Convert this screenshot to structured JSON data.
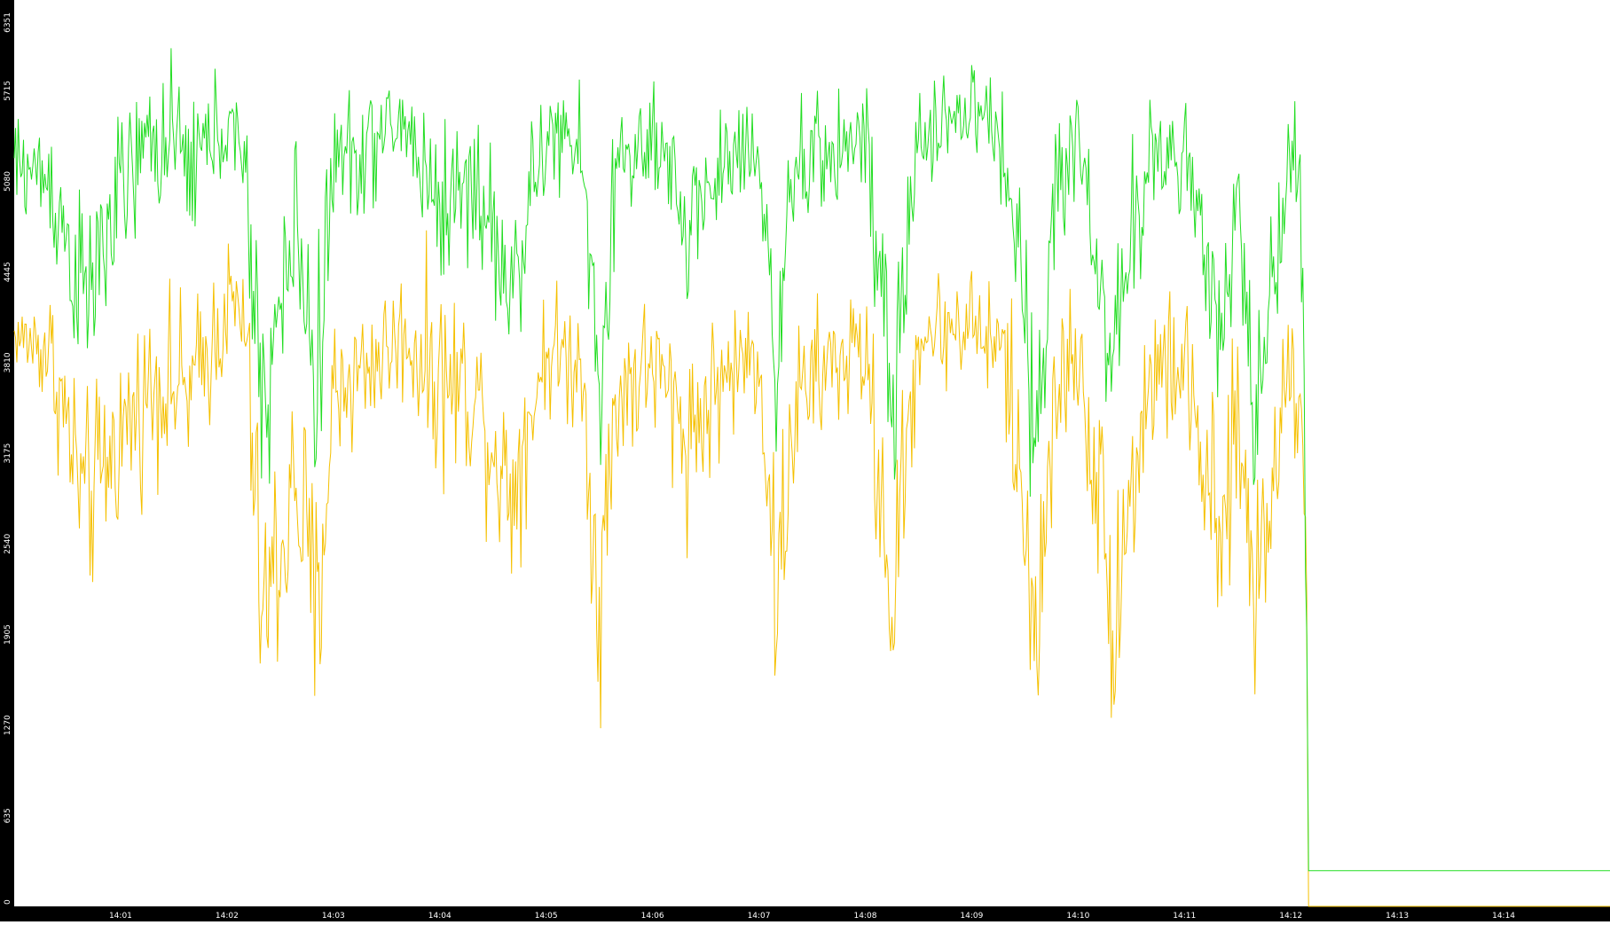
{
  "chart_data": {
    "type": "line",
    "title": "",
    "xlabel": "",
    "ylabel": "",
    "x_range": [
      "14:00",
      "14:15"
    ],
    "ylim": [
      0,
      6351
    ],
    "grid": false,
    "legend": "none",
    "x_ticks": [
      "14:01",
      "14:02",
      "14:03",
      "14:04",
      "14:05",
      "14:06",
      "14:07",
      "14:08",
      "14:09",
      "14:10",
      "14:11",
      "14:12",
      "14:13",
      "14:14"
    ],
    "y_ticks": [
      "0",
      "635",
      "1270",
      "1905",
      "2540",
      "3175",
      "3810",
      "4445",
      "5080",
      "5715",
      "6351"
    ],
    "series": [
      {
        "color": "#f5c000",
        "x": [
          "14:00:00",
          "14:00:20",
          "14:00:40",
          "14:01:00",
          "14:01:20",
          "14:01:40",
          "14:02:00",
          "14:02:10",
          "14:02:20",
          "14:02:40",
          "14:02:50",
          "14:03:00",
          "14:03:20",
          "14:03:40",
          "14:04:00",
          "14:04:20",
          "14:04:40",
          "14:05:00",
          "14:05:20",
          "14:05:30",
          "14:05:40",
          "14:06:00",
          "14:06:20",
          "14:06:40",
          "14:07:00",
          "14:07:10",
          "14:07:20",
          "14:07:40",
          "14:08:00",
          "14:08:15",
          "14:08:30",
          "14:09:00",
          "14:09:20",
          "14:09:35",
          "14:09:50",
          "14:10:00",
          "14:10:20",
          "14:10:40",
          "14:11:00",
          "14:11:20",
          "14:11:30",
          "14:11:40",
          "14:12:00",
          "14:12:07",
          "14:12:09",
          "14:12:10",
          "14:15:00"
        ],
        "y": [
          4000,
          3900,
          2800,
          3300,
          3700,
          3600,
          4200,
          4100,
          2000,
          3000,
          1900,
          3600,
          3800,
          4000,
          3700,
          3600,
          2900,
          3900,
          3800,
          2100,
          3600,
          3800,
          3300,
          3700,
          3900,
          2100,
          3500,
          3800,
          3900,
          2100,
          4000,
          4100,
          3800,
          2000,
          3700,
          3900,
          2100,
          3700,
          3800,
          2400,
          3400,
          2200,
          3900,
          3400,
          1900,
          0,
          0
        ],
        "spread": [
          300,
          700,
          1100,
          900,
          900,
          900,
          700,
          900,
          1300,
          1300,
          1500,
          900,
          700,
          700,
          1100,
          900,
          1000,
          700,
          700,
          1300,
          900,
          700,
          1000,
          700,
          700,
          1300,
          900,
          700,
          700,
          1300,
          600,
          600,
          900,
          1300,
          900,
          700,
          1300,
          900,
          700,
          1300,
          900,
          1300,
          700,
          800,
          900,
          0,
          0
        ]
      },
      {
        "color": "#22dd22",
        "x": [
          "14:00:00",
          "14:00:20",
          "14:00:40",
          "14:01:00",
          "14:01:20",
          "14:01:40",
          "14:02:00",
          "14:02:10",
          "14:02:20",
          "14:02:40",
          "14:02:50",
          "14:03:00",
          "14:03:20",
          "14:03:40",
          "14:04:00",
          "14:04:20",
          "14:04:40",
          "14:05:00",
          "14:05:20",
          "14:05:30",
          "14:05:40",
          "14:06:00",
          "14:06:20",
          "14:06:40",
          "14:07:00",
          "14:07:10",
          "14:07:20",
          "14:07:40",
          "14:08:00",
          "14:08:15",
          "14:08:30",
          "14:09:00",
          "14:09:20",
          "14:09:35",
          "14:09:50",
          "14:10:00",
          "14:10:20",
          "14:10:40",
          "14:11:00",
          "14:11:20",
          "14:11:30",
          "14:11:40",
          "14:12:00",
          "14:12:07",
          "14:12:08",
          "14:12:09",
          "14:12:10",
          "14:15:00"
        ],
        "y": [
          5200,
          5100,
          4200,
          5000,
          5400,
          5200,
          5500,
          5100,
          3500,
          4800,
          3600,
          5200,
          5300,
          5500,
          4900,
          5100,
          4300,
          5400,
          5300,
          3600,
          5200,
          5300,
          4800,
          5200,
          5400,
          3700,
          5100,
          5300,
          5400,
          3400,
          5400,
          5600,
          5300,
          3500,
          5100,
          5400,
          3800,
          5300,
          5300,
          3800,
          4900,
          3500,
          5300,
          4700,
          2800,
          1900,
          250,
          250
        ],
        "spread": [
          500,
          700,
          1000,
          800,
          800,
          800,
          600,
          800,
          1100,
          1000,
          1200,
          800,
          600,
          600,
          900,
          800,
          900,
          600,
          600,
          1100,
          800,
          600,
          900,
          600,
          600,
          1100,
          800,
          600,
          600,
          1100,
          500,
          500,
          800,
          1100,
          800,
          600,
          1100,
          800,
          600,
          1100,
          800,
          1100,
          600,
          700,
          600,
          400,
          0,
          0
        ]
      }
    ]
  }
}
